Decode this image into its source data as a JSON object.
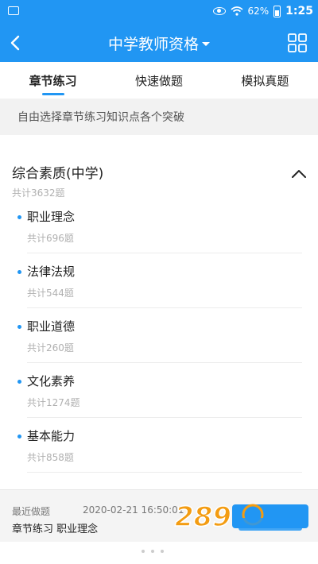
{
  "status": {
    "battery_pct": "62%",
    "time": "1:25"
  },
  "header": {
    "title": "中学教师资格"
  },
  "tabs": [
    {
      "label": "章节练习",
      "active": true
    },
    {
      "label": "快速做题",
      "active": false
    },
    {
      "label": "模拟真题",
      "active": false
    }
  ],
  "hint": "自由选择章节练习知识点各个突破",
  "section": {
    "title": "综合素质(中学)",
    "count": "共计3632题",
    "items": [
      {
        "label": "职业理念",
        "count": "共计696题"
      },
      {
        "label": "法律法规",
        "count": "共计544题"
      },
      {
        "label": "职业道德",
        "count": "共计260题"
      },
      {
        "label": "文化素养",
        "count": "共计1274题"
      },
      {
        "label": "基本能力",
        "count": "共计858题"
      }
    ]
  },
  "recent": {
    "label": "最近做题",
    "time": "2020-02-21 16:50:01",
    "item": "章节练习 职业理念"
  },
  "colors": {
    "primary": "#2196f3",
    "watermark_orange": "#f39c12"
  }
}
